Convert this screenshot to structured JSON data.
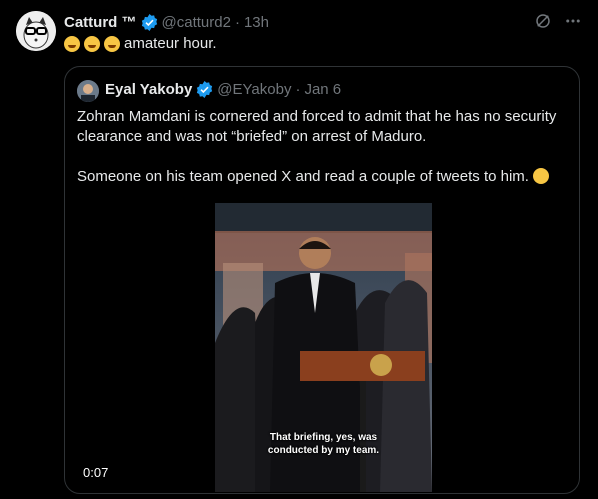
{
  "tweet": {
    "author_name": "Catturd ™",
    "handle": "@catturd2",
    "time": "13h",
    "text": "amateur hour.",
    "emojis": [
      "joy-emoji",
      "joy-emoji",
      "joy-emoji"
    ]
  },
  "quote": {
    "author_name": "Eyal Yakoby",
    "handle": "@EYakoby",
    "time": "Jan 6",
    "paragraph1": "Zohran Mamdani is cornered and forced to admit that he has no security clearance and was not “briefed” on arrest of Maduro.",
    "paragraph2": "Someone on his team opened X and read a couple of tweets to him.",
    "video": {
      "timestamp": "0:07",
      "caption_line1": "That briefing, yes, was",
      "caption_line2": "conducted by my team."
    }
  },
  "colors": {
    "background": "#000000",
    "verified": "#1d9bf0",
    "muted": "#71767b",
    "border": "#2f3336"
  }
}
